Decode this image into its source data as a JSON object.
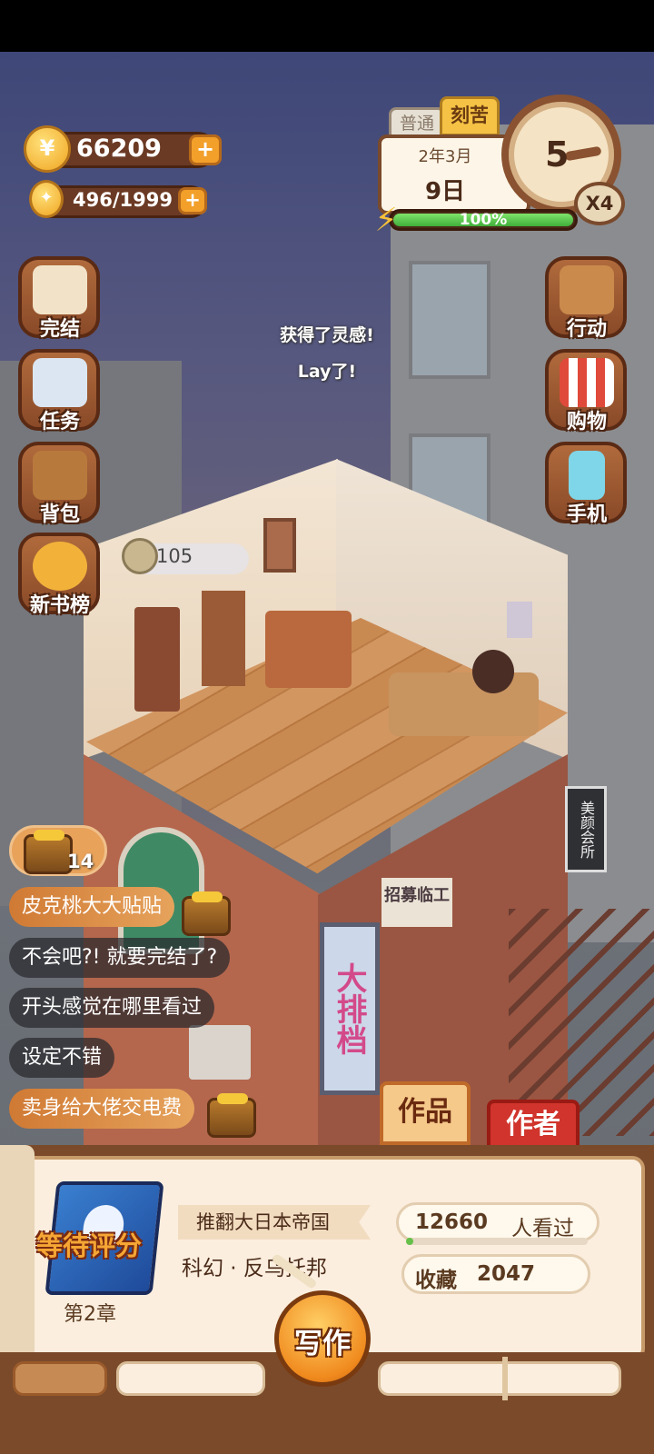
{
  "resources": {
    "coins": "66209",
    "inspiration": "496/1999",
    "plus": "+"
  },
  "calendar": {
    "tab_normal": "普通",
    "tab_hard": "刻苦",
    "month": "2年3月",
    "day": "9日",
    "clock_number": "5",
    "speed": "X4",
    "energy_percent_text": "100%",
    "energy_fraction": 1.0,
    "bolt": "⚡"
  },
  "left_menu": [
    {
      "label": "完结",
      "icon": "book-icon"
    },
    {
      "label": "任务",
      "icon": "checklist-icon"
    },
    {
      "label": "背包",
      "icon": "backpack-icon"
    },
    {
      "label": "新书榜",
      "icon": "medal-icon"
    }
  ],
  "right_menu": [
    {
      "label": "行动",
      "icon": "door-icon"
    },
    {
      "label": "购物",
      "icon": "shop-icon"
    },
    {
      "label": "手机",
      "icon": "phone-icon"
    }
  ],
  "notice": {
    "line1": "获得了灵感!",
    "line2": "Lay了!"
  },
  "room": {
    "coin_bubble": "105",
    "sign_recruit": "招募临工",
    "sign_vertical": "大排档",
    "sign_beauty": "美颜会所"
  },
  "chest": {
    "count": "14"
  },
  "comments": [
    {
      "text": "皮克桃大大贴贴",
      "style": "gold",
      "has_chest": true
    },
    {
      "text": "不会吧?! 就要完结了?",
      "style": "dark",
      "has_chest": false
    },
    {
      "text": "开头感觉在哪里看过",
      "style": "dark",
      "has_chest": false
    },
    {
      "text": "设定不错",
      "style": "dark",
      "has_chest": false
    },
    {
      "text": "卖身给大佬交电费",
      "style": "gold",
      "has_chest": true
    }
  ],
  "tabs": {
    "works": "作品",
    "author": "作者"
  },
  "book": {
    "pending": "等待评分",
    "chapter": "第2章",
    "title": "推翻大日本帝国",
    "genre": "科幻 · 反乌托邦",
    "views_count": "12660",
    "views_label": "人看过",
    "views_fraction": 0.04,
    "fav_label": "收藏",
    "fav_count": "2047"
  },
  "write_button": "写作",
  "colors": {
    "accent_orange": "#f2a02a",
    "panel_brown": "#7a4a2a",
    "author_red": "#d0342c"
  }
}
